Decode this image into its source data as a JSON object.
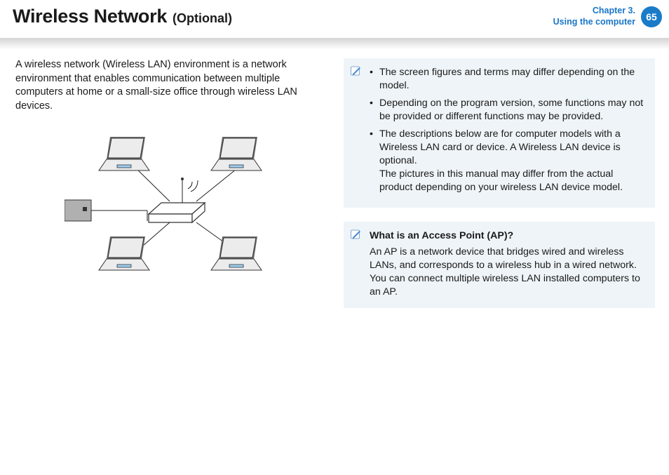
{
  "header": {
    "title": "Wireless Network",
    "subtitle": "(Optional)",
    "chapter_label": "Chapter 3.",
    "chapter_sub": "Using the computer",
    "page_number": "65"
  },
  "left": {
    "intro": "A wireless network (Wireless LAN) environment is a network environment that enables communication between multiple computers at home or a small-size office through wireless LAN devices."
  },
  "note_box": {
    "bullets": [
      "The screen figures and terms may differ depending on the model.",
      "Depending on the program version, some functions may not be provided or different functions may be provided.",
      "The descriptions below are for computer models with a Wireless LAN card or device. A Wireless LAN device is optional.\nThe pictures in this manual may differ from the actual product depending on your wireless LAN device model."
    ]
  },
  "ap_box": {
    "title": "What is an Access Point (AP)?",
    "body": "An AP is a network device that bridges wired and wireless LANs, and corresponds to a wireless hub in a wired network. You can connect multiple wireless LAN installed computers to an AP."
  }
}
